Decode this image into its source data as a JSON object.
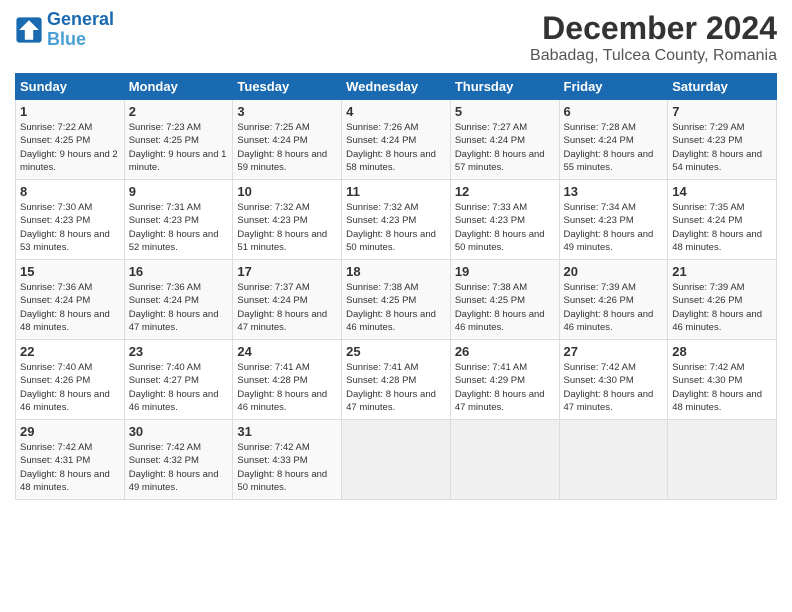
{
  "header": {
    "logo_line1": "General",
    "logo_line2": "Blue",
    "title": "December 2024",
    "subtitle": "Babadag, Tulcea County, Romania"
  },
  "weekdays": [
    "Sunday",
    "Monday",
    "Tuesday",
    "Wednesday",
    "Thursday",
    "Friday",
    "Saturday"
  ],
  "weeks": [
    [
      {
        "day": "1",
        "sunrise": "7:22 AM",
        "sunset": "4:25 PM",
        "daylight": "9 hours and 2 minutes."
      },
      {
        "day": "2",
        "sunrise": "7:23 AM",
        "sunset": "4:25 PM",
        "daylight": "9 hours and 1 minute."
      },
      {
        "day": "3",
        "sunrise": "7:25 AM",
        "sunset": "4:24 PM",
        "daylight": "8 hours and 59 minutes."
      },
      {
        "day": "4",
        "sunrise": "7:26 AM",
        "sunset": "4:24 PM",
        "daylight": "8 hours and 58 minutes."
      },
      {
        "day": "5",
        "sunrise": "7:27 AM",
        "sunset": "4:24 PM",
        "daylight": "8 hours and 57 minutes."
      },
      {
        "day": "6",
        "sunrise": "7:28 AM",
        "sunset": "4:24 PM",
        "daylight": "8 hours and 55 minutes."
      },
      {
        "day": "7",
        "sunrise": "7:29 AM",
        "sunset": "4:23 PM",
        "daylight": "8 hours and 54 minutes."
      }
    ],
    [
      {
        "day": "8",
        "sunrise": "7:30 AM",
        "sunset": "4:23 PM",
        "daylight": "8 hours and 53 minutes."
      },
      {
        "day": "9",
        "sunrise": "7:31 AM",
        "sunset": "4:23 PM",
        "daylight": "8 hours and 52 minutes."
      },
      {
        "day": "10",
        "sunrise": "7:32 AM",
        "sunset": "4:23 PM",
        "daylight": "8 hours and 51 minutes."
      },
      {
        "day": "11",
        "sunrise": "7:32 AM",
        "sunset": "4:23 PM",
        "daylight": "8 hours and 50 minutes."
      },
      {
        "day": "12",
        "sunrise": "7:33 AM",
        "sunset": "4:23 PM",
        "daylight": "8 hours and 50 minutes."
      },
      {
        "day": "13",
        "sunrise": "7:34 AM",
        "sunset": "4:23 PM",
        "daylight": "8 hours and 49 minutes."
      },
      {
        "day": "14",
        "sunrise": "7:35 AM",
        "sunset": "4:24 PM",
        "daylight": "8 hours and 48 minutes."
      }
    ],
    [
      {
        "day": "15",
        "sunrise": "7:36 AM",
        "sunset": "4:24 PM",
        "daylight": "8 hours and 48 minutes."
      },
      {
        "day": "16",
        "sunrise": "7:36 AM",
        "sunset": "4:24 PM",
        "daylight": "8 hours and 47 minutes."
      },
      {
        "day": "17",
        "sunrise": "7:37 AM",
        "sunset": "4:24 PM",
        "daylight": "8 hours and 47 minutes."
      },
      {
        "day": "18",
        "sunrise": "7:38 AM",
        "sunset": "4:25 PM",
        "daylight": "8 hours and 46 minutes."
      },
      {
        "day": "19",
        "sunrise": "7:38 AM",
        "sunset": "4:25 PM",
        "daylight": "8 hours and 46 minutes."
      },
      {
        "day": "20",
        "sunrise": "7:39 AM",
        "sunset": "4:26 PM",
        "daylight": "8 hours and 46 minutes."
      },
      {
        "day": "21",
        "sunrise": "7:39 AM",
        "sunset": "4:26 PM",
        "daylight": "8 hours and 46 minutes."
      }
    ],
    [
      {
        "day": "22",
        "sunrise": "7:40 AM",
        "sunset": "4:26 PM",
        "daylight": "8 hours and 46 minutes."
      },
      {
        "day": "23",
        "sunrise": "7:40 AM",
        "sunset": "4:27 PM",
        "daylight": "8 hours and 46 minutes."
      },
      {
        "day": "24",
        "sunrise": "7:41 AM",
        "sunset": "4:28 PM",
        "daylight": "8 hours and 46 minutes."
      },
      {
        "day": "25",
        "sunrise": "7:41 AM",
        "sunset": "4:28 PM",
        "daylight": "8 hours and 47 minutes."
      },
      {
        "day": "26",
        "sunrise": "7:41 AM",
        "sunset": "4:29 PM",
        "daylight": "8 hours and 47 minutes."
      },
      {
        "day": "27",
        "sunrise": "7:42 AM",
        "sunset": "4:30 PM",
        "daylight": "8 hours and 47 minutes."
      },
      {
        "day": "28",
        "sunrise": "7:42 AM",
        "sunset": "4:30 PM",
        "daylight": "8 hours and 48 minutes."
      }
    ],
    [
      {
        "day": "29",
        "sunrise": "7:42 AM",
        "sunset": "4:31 PM",
        "daylight": "8 hours and 48 minutes."
      },
      {
        "day": "30",
        "sunrise": "7:42 AM",
        "sunset": "4:32 PM",
        "daylight": "8 hours and 49 minutes."
      },
      {
        "day": "31",
        "sunrise": "7:42 AM",
        "sunset": "4:33 PM",
        "daylight": "8 hours and 50 minutes."
      },
      null,
      null,
      null,
      null
    ]
  ]
}
